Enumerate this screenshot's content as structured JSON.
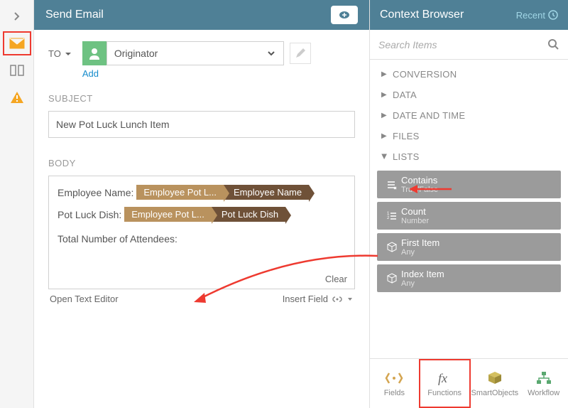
{
  "header": {
    "title": "Send Email"
  },
  "leftRail": {
    "items": [
      "collapse",
      "mail",
      "columns",
      "warning"
    ]
  },
  "form": {
    "toLabel": "TO",
    "originator": "Originator",
    "addLink": "Add",
    "subjectLabel": "SUBJECT",
    "subjectValue": "New Pot Luck Lunch Item",
    "bodyLabel": "BODY",
    "bodyLines": [
      {
        "prefix": "Employee Name: ",
        "tokenA": "Employee Pot L...",
        "tokenB": "Employee Name"
      },
      {
        "prefix": "Pot Luck Dish: ",
        "tokenA": "Employee Pot L...",
        "tokenB": "Pot Luck Dish"
      }
    ],
    "attendeesLine": "Total Number of Attendees:",
    "clearLabel": "Clear",
    "openEditor": "Open Text Editor",
    "insertField": "Insert Field"
  },
  "context": {
    "title": "Context Browser",
    "recent": "Recent",
    "searchPlaceholder": "Search Items",
    "categories": [
      {
        "label": "CONVERSION",
        "expanded": false
      },
      {
        "label": "DATA",
        "expanded": false
      },
      {
        "label": "DATE AND TIME",
        "expanded": false
      },
      {
        "label": "FILES",
        "expanded": false
      },
      {
        "label": "LISTS",
        "expanded": true
      }
    ],
    "functions": [
      {
        "name": "Contains",
        "type": "True/False",
        "icon": "contains"
      },
      {
        "name": "Count",
        "type": "Number",
        "icon": "count"
      },
      {
        "name": "First Item",
        "type": "Any",
        "icon": "cube"
      },
      {
        "name": "Index Item",
        "type": "Any",
        "icon": "cube"
      }
    ],
    "bottomTabs": [
      {
        "label": "Fields",
        "icon": "brackets"
      },
      {
        "label": "Functions",
        "icon": "fx",
        "active": true
      },
      {
        "label": "SmartObjects",
        "icon": "cube3d"
      },
      {
        "label": "Workflow",
        "icon": "workflow"
      }
    ]
  }
}
